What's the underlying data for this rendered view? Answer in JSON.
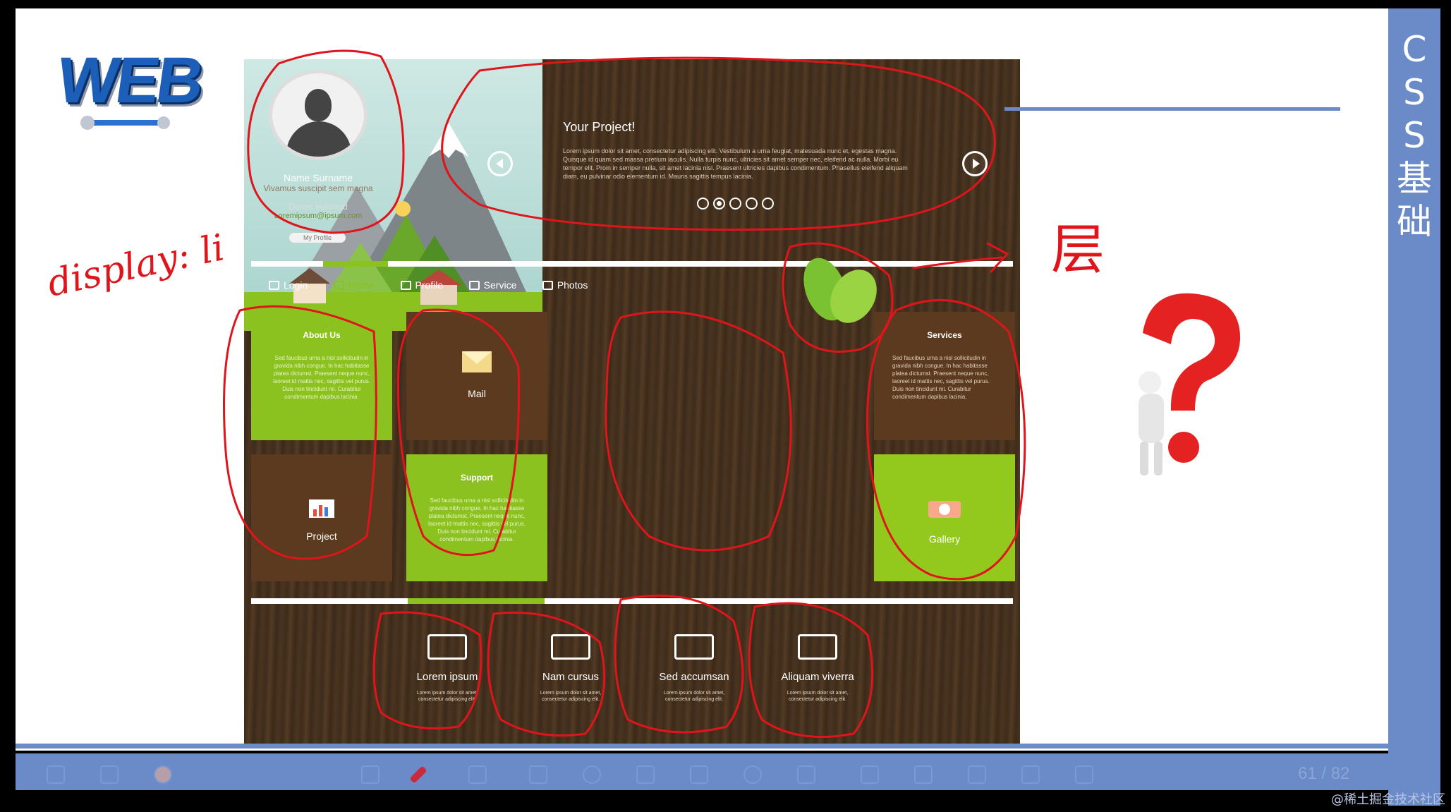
{
  "side_title": [
    "C",
    "S",
    "S",
    "基",
    "础"
  ],
  "logo_text": "WEB",
  "profile": {
    "name": "Name Surname",
    "subtitle": "Vivamus suscipit sem magna",
    "text": "Donec euismod",
    "email": "Loremipsum@ipsum.com",
    "button": "My Profile"
  },
  "slider": {
    "title": "Your Project!",
    "body": "Lorem ipsum dolor sit amet, consectetur adipiscing elit. Vestibulum a urna feugiat, malesuada nunc et, egestas magna. Quisque id quam sed massa pretium iaculis. Nulla turpis nunc, ultricies sit amet semper nec, eleifend ac nulla. Morbi eu tempor elit. Proin in semper nulla, sit amet lacinia nisl. Praesent ultricies dapibus condimentum. Phasellus eleifend aliquam diam, eu pulvinar odio elementum id. Mauris sagittis tempus lacinia.",
    "dots_count": 5,
    "active_dot": 1
  },
  "nav": [
    {
      "label": "Login",
      "icon": "login-icon",
      "active": false
    },
    {
      "label": "Home",
      "icon": "home-icon",
      "active": true
    },
    {
      "label": "Profile",
      "icon": "profile-icon",
      "active": false
    },
    {
      "label": "Service",
      "icon": "service-icon",
      "active": false
    },
    {
      "label": "Photos",
      "icon": "camera-icon",
      "active": false
    }
  ],
  "tiles": {
    "about": {
      "title": "About Us",
      "text": "Sed faucibus urna a nisl sollicitudin in gravida nibh congue. In hac habitasse platea dictumst. Praesent neque nunc, laoreet id mattis nec, sagittis vel purus. Duis non tincidunt mi. Curabitur condimentum dapibus lacinia."
    },
    "project": {
      "label": "Project"
    },
    "mail": {
      "label": "Mail"
    },
    "support": {
      "title": "Support",
      "text": "Sed faucibus urna a nisl sollicitudin in gravida nibh congue. In hac habitasse platea dictumst. Praesent neque nunc, laoreet id mattis nec, sagittis vel purus. Duis non tincidunt mi. Curabitur condimentum dapibus lacinia."
    },
    "services": {
      "title": "Services",
      "text": "Sed faucibus urna a nisl sollicitudin in gravida nibh congue. In hac habitasse platea dictumst. Praesent neque nunc, laoreet id mattis nec, sagittis vel purus. Duis non tincidunt mi. Curabitur condimentum dapibus lacinia."
    },
    "gallery": {
      "label": "Gallery"
    }
  },
  "footer": [
    {
      "label": "Lorem ipsum",
      "text": "Lorem ipsum dolor sit amet, consectetur adipiscing elit.",
      "icon": "computer-icon"
    },
    {
      "label": "Nam cursus",
      "text": "Lorem ipsum dolor sit amet, consectetur adipiscing elit.",
      "icon": "camera-icon"
    },
    {
      "label": "Sed accumsan",
      "text": "Lorem ipsum dolor sit amet, consectetur adipiscing elit.",
      "icon": "chat-user-icon"
    },
    {
      "label": "Aliquam viverra",
      "text": "Lorem ipsum dolor sit amet, consectetur adipiscing elit.",
      "icon": "cart-icon"
    }
  ],
  "annotations": {
    "display_note": "display: li",
    "layer_note": "层"
  },
  "page_counter": "61 / 82",
  "watermark": "@稀土掘金技术社区",
  "colors": {
    "accent_green": "#8cc21f",
    "wood_brown": "#4a3420",
    "tile_brown": "#5b3a1f",
    "band_blue": "#6a8bc8",
    "annotation_red": "#e0141b"
  }
}
